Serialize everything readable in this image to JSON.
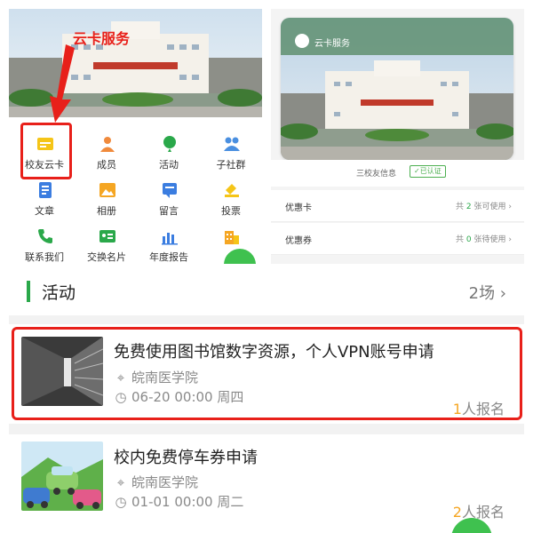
{
  "annotation": {
    "label": "云卡服务"
  },
  "menu": {
    "items": [
      {
        "label": "校友云卡",
        "icon": "card-icon",
        "color": "#f5c518"
      },
      {
        "label": "成员",
        "icon": "members-icon",
        "color": "#f08a3c"
      },
      {
        "label": "活动",
        "icon": "balloon-icon",
        "color": "#2aa84a"
      },
      {
        "label": "子社群",
        "icon": "group-icon",
        "color": "#4a8fe0"
      },
      {
        "label": "文章",
        "icon": "article-icon",
        "color": "#3b7de0"
      },
      {
        "label": "相册",
        "icon": "album-icon",
        "color": "#f5a623"
      },
      {
        "label": "留言",
        "icon": "message-icon",
        "color": "#3b7de0"
      },
      {
        "label": "投票",
        "icon": "vote-icon",
        "color": "#f5c518"
      },
      {
        "label": "联系我们",
        "icon": "phone-icon",
        "color": "#2aa84a"
      },
      {
        "label": "交换名片",
        "icon": "namecard-icon",
        "color": "#2aa84a"
      },
      {
        "label": "年度报告",
        "icon": "report-icon",
        "color": "#3b7de0"
      },
      {
        "label": "",
        "icon": "building-icon",
        "color": "#f5a623"
      }
    ]
  },
  "card": {
    "title": "云卡服务",
    "verify_text": "三校友信息",
    "verify_badge": "✓已认证",
    "rows": [
      {
        "label": "优惠卡",
        "prefix": "共",
        "count": "2",
        "suffix": "张可使用 ›"
      },
      {
        "label": "优惠券",
        "prefix": "共",
        "count": "0",
        "suffix": "张待使用 ›"
      }
    ]
  },
  "activity": {
    "title": "活动",
    "count": "2场 ›",
    "items": [
      {
        "title": "免费使用图书馆数字资源，个人VPN账号申请",
        "location": "皖南医学院",
        "time": "06-20 00:00  周四",
        "signups": "1",
        "signup_suffix": "人报名"
      },
      {
        "title": "校内免费停车券申请",
        "location": "皖南医学院",
        "time": "01-01 00:00  周二",
        "signups": "2",
        "signup_suffix": "人报名"
      }
    ]
  },
  "colors": {
    "accent": "#2aa84a",
    "highlight": "#e8201a",
    "orange": "#f5a623"
  }
}
